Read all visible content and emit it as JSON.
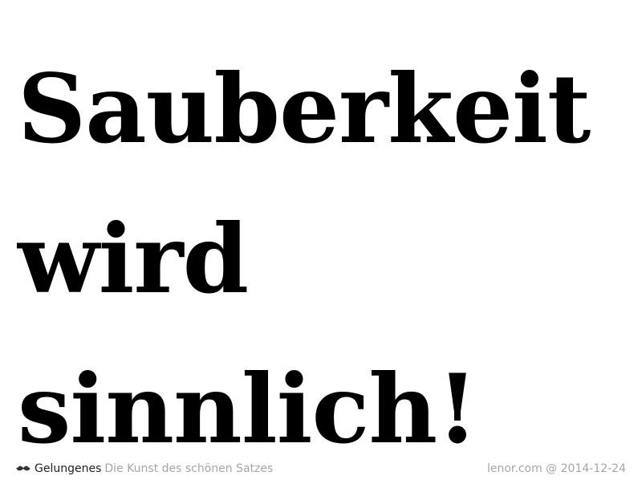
{
  "headline": {
    "lines": [
      "Sauberkeit",
      "wird",
      "sinnlich!"
    ]
  },
  "footer": {
    "icon": "mustache-icon",
    "brand": "Gelungenes",
    "tagline": "Die Kunst des schönen Satzes",
    "credit": "lenor.com @ 2014-12-24"
  },
  "colors": {
    "background": "#ffffff",
    "headline": "#000000",
    "brand": "#222222",
    "muted": "#a6a6a6"
  }
}
